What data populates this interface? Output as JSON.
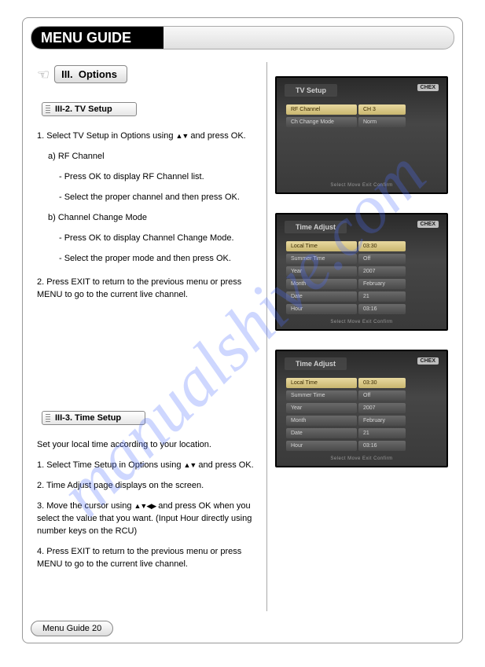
{
  "header": {
    "title": "MENU GUIDE"
  },
  "section": {
    "roman": "III.",
    "name": "Options"
  },
  "watermark": "manualshive.com",
  "footer": "Menu Guide 20",
  "tv_setup": {
    "chip": "III-2. TV Setup",
    "line1_pre": "1. Select TV Setup in Options using ",
    "line1_post": " and press OK.",
    "a_head": "a) RF Channel",
    "a_b1": "- Press OK to display RF Channel list.",
    "a_b2": "- Select the proper channel and then press OK.",
    "b_head": "b) Channel Change Mode",
    "b_b1": "- Press OK to display Channel Change Mode.",
    "b_b2": "- Select the proper mode and then press OK.",
    "line2": "2. Press EXIT to return to the previous menu or press MENU to go to the current live channel."
  },
  "time_setup": {
    "chip": "III-3. Time Setup",
    "intro": "Set your local time according to your location.",
    "l1_pre": "1. Select Time Setup in Options using ",
    "l1_post": " and press OK.",
    "l2": "2. Time Adjust page displays on the screen.",
    "l3_pre": "3. Move the cursor using ",
    "l3_post": " and press OK when you select the value that you want. (Input Hour directly using number keys on the RCU)",
    "l4": "4. Press EXIT to return to the previous menu or press MENU to go to the current live channel."
  },
  "screens": {
    "badge": "CHEX",
    "hint": "Select  Move  Exit  Confirm",
    "s1": {
      "title": "TV Setup",
      "rows": [
        {
          "label": "RF Channel",
          "val": "CH 3",
          "hl": true
        },
        {
          "label": "Ch Change Mode",
          "val": "Norm",
          "hl": false
        }
      ]
    },
    "s2": {
      "title": "Time Adjust",
      "rows": [
        {
          "label": "Local Time",
          "val": "03:30",
          "hl": true
        },
        {
          "label": "Summer Time",
          "val": "Off",
          "hl": false
        },
        {
          "label": "Year",
          "val": "2007",
          "hl": false
        },
        {
          "label": "Month",
          "val": "February",
          "hl": false
        },
        {
          "label": "Date",
          "val": "21",
          "hl": false
        },
        {
          "label": "Hour",
          "val": "03:16",
          "hl": false
        }
      ]
    },
    "s3": {
      "title": "Time Adjust",
      "rows": [
        {
          "label": "Local Time",
          "val": "03:30",
          "hl": true
        },
        {
          "label": "Summer Time",
          "val": "Off",
          "hl": false
        },
        {
          "label": "Year",
          "val": "2007",
          "hl": false
        },
        {
          "label": "Month",
          "val": "February",
          "hl": false
        },
        {
          "label": "Date",
          "val": "21",
          "hl": false
        },
        {
          "label": "Hour",
          "val": "03:16",
          "hl": false
        }
      ]
    }
  },
  "glyphs": {
    "updown": "▲▼",
    "all4": "▲▼◀▶"
  }
}
